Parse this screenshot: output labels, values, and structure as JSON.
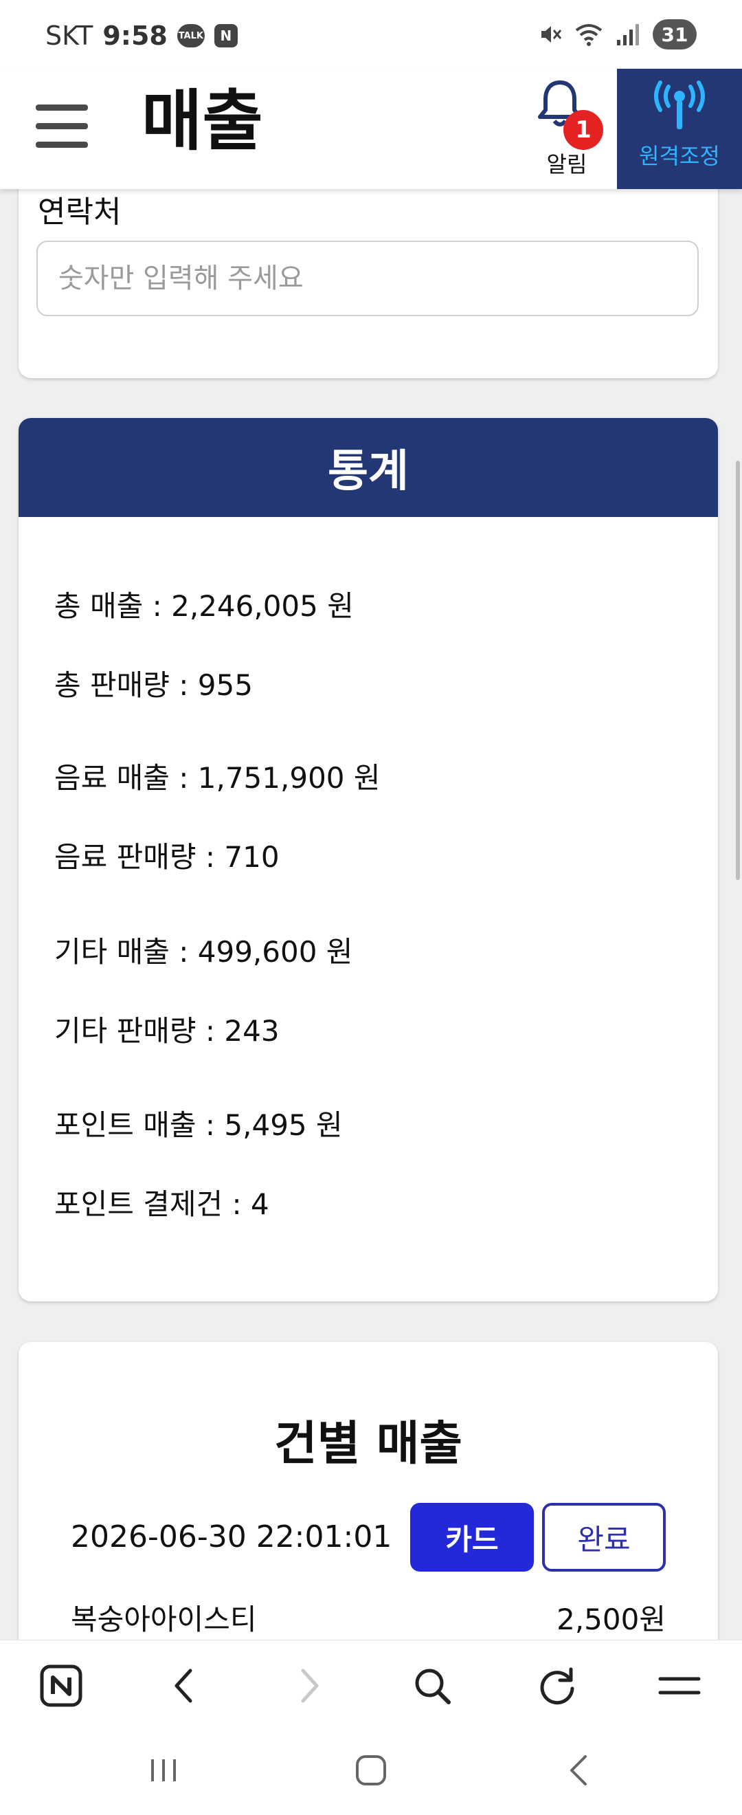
{
  "status_bar": {
    "carrier": "SKT",
    "time": "9:58",
    "talk_label": "TALK",
    "n_label": "N",
    "battery": "31"
  },
  "header": {
    "title": "매출",
    "notification_label": "알림",
    "notification_count": "1",
    "remote_label": "원격조정"
  },
  "contact": {
    "label": "연락처",
    "placeholder": "숫자만 입력해 주세요",
    "value": ""
  },
  "stats": {
    "title": "통계",
    "total_sales": "총 매출 : 2,246,005 원",
    "total_qty": "총 판매량 : 955",
    "drink_sales": "음료 매출 : 1,751,900 원",
    "drink_qty": "음료 판매량 : 710",
    "other_sales": "기타 매출 : 499,600 원",
    "other_qty": "기타 판매량 : 243",
    "point_sales": "포인트 매출 : 5,495 원",
    "point_count": "포인트 결제건 : 4"
  },
  "sales": {
    "title": "건별 매출",
    "entries": [
      {
        "datetime": "2026-06-30 22:01:01",
        "method": "카드",
        "status": "완료",
        "item": "복숭아아이스티",
        "price": "2,500원"
      }
    ]
  },
  "colors": {
    "navy": "#223774",
    "card_button": "#2328d8",
    "remote_text": "#2fb4ff",
    "badge": "#e52222"
  }
}
